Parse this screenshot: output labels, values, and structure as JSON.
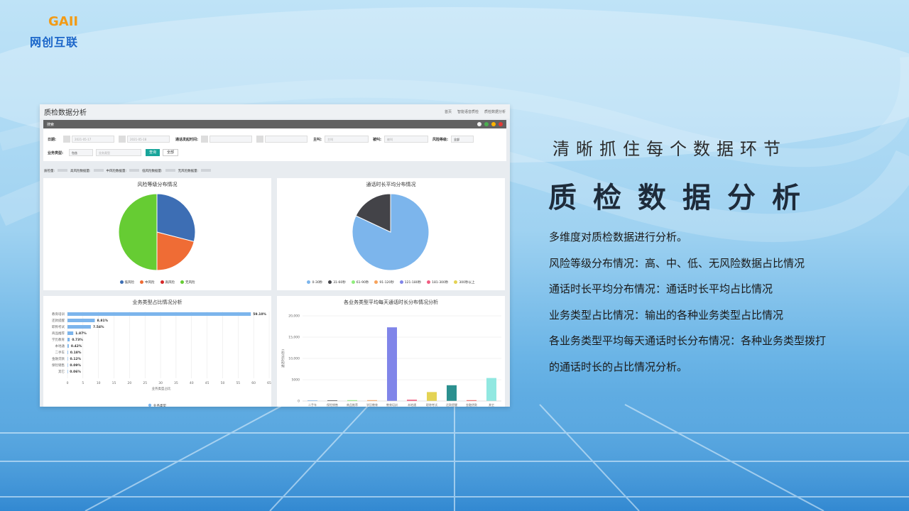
{
  "logo": {
    "mark": "GAII",
    "text": "网创互联"
  },
  "panel": {
    "title": "质检数据分析",
    "breadcrumbs": [
      "首页",
      "智能语音质检",
      "质检数据分析"
    ],
    "search_bar_label": "搜索",
    "filters": {
      "date_label": "日期:",
      "date_start": "2021-05-17",
      "date_end": "2021-05-18",
      "call_duration_label": "通话发起时间:",
      "caller_label": "主叫:",
      "caller_placeholder": "主叫",
      "callee_label": "被叫:",
      "callee_placeholder": "被叫",
      "risk_level_label": "风险等级:",
      "risk_level_value": "全部",
      "business_type_label": "业务类型:",
      "business_type_value": "包含",
      "business_type_placeholder": "业务类型",
      "query_button": "查询",
      "all_button": "全部"
    },
    "stats": [
      "质检量:",
      "高风险数据量:",
      "中风险数据量:",
      "低风险数据量:",
      "无风险数据量:"
    ],
    "risk_chart": {
      "title": "风险等级分布情况",
      "type": "pie",
      "legend": [
        "低风险",
        "中风险",
        "高风险",
        "无风险"
      ]
    },
    "duration_chart": {
      "title": "通话时长平均分布情况",
      "type": "pie",
      "legend": [
        "0-30秒",
        "31-60秒",
        "61-90秒",
        "91-120秒",
        "121-180秒",
        "181-300秒",
        "300秒以上"
      ]
    },
    "business_chart": {
      "title": "业务类型占比情况分析",
      "axis_label": "业务类型占比",
      "legend": "业务类型",
      "ticks": [
        "0",
        "5",
        "10",
        "15",
        "20",
        "25",
        "30",
        "35",
        "40",
        "45",
        "50",
        "55",
        "60",
        "65"
      ]
    },
    "avg_chart": {
      "title": "各业务类型平均每天通话时长分布情况分析",
      "ylabel": "通话时长(秒)",
      "yticks": [
        "0",
        "5000",
        "10,000",
        "15,000",
        "20,000"
      ]
    }
  },
  "chart_data": [
    {
      "type": "pie",
      "title": "风险等级分布情况",
      "categories": [
        "低风险",
        "中风险",
        "高风险",
        "无风险"
      ],
      "values": [
        29,
        21,
        0,
        50
      ],
      "colors": [
        "#3d6eb4",
        "#ef6c35",
        "#d62728",
        "#66cc33"
      ]
    },
    {
      "type": "pie",
      "title": "通话时长平均分布情况",
      "categories": [
        "0-30秒",
        "31-60秒",
        "61-90秒",
        "91-120秒",
        "121-180秒",
        "181-300秒",
        "300秒以上"
      ],
      "values": [
        82,
        18,
        0,
        0,
        0,
        0,
        0
      ],
      "colors": [
        "#7cb5ec",
        "#434348",
        "#90ed7d",
        "#f7a35c",
        "#8085e9",
        "#f15c80",
        "#e4d354"
      ]
    },
    {
      "type": "bar",
      "title": "业务类型占比情况分析",
      "categories": [
        "教育培训",
        "还款提醒",
        "职称考试",
        "商品推荐",
        "学历教育",
        "本地通",
        "二手车",
        "金融贷款",
        "保险销售",
        "其它"
      ],
      "values": [
        59.1,
        8.81,
        7.54,
        1.87,
        0.73,
        0.42,
        0.18,
        0.12,
        0.09,
        0.06
      ],
      "labels": [
        "59.10%",
        "8.81%",
        "7.54%",
        "1.87%",
        "0.73%",
        "0.42%",
        "0.18%",
        "0.12%",
        "0.09%",
        "0.06%"
      ],
      "xlim": [
        0,
        65
      ],
      "xlabel": "业务类型占比",
      "series_name": "业务类型",
      "color": "#7cb5ec"
    },
    {
      "type": "bar",
      "title": "各业务类型平均每天通话时长分布情况分析",
      "categories": [
        "二手车",
        "保险销售",
        "商品推荐",
        "学历教育",
        "教育培训",
        "本地通",
        "职称考试",
        "还款提醒",
        "金融贷款",
        "其它"
      ],
      "values": [
        150,
        150,
        200,
        200,
        17300,
        300,
        2100,
        3700,
        200,
        5400
      ],
      "colors": [
        "#7cb5ec",
        "#434348",
        "#90ed7d",
        "#f7a35c",
        "#8085e9",
        "#f15c80",
        "#e4d354",
        "#2b908f",
        "#f45b5b",
        "#91e8e1"
      ],
      "ylim": [
        0,
        20000
      ],
      "ylabel": "通话时长(秒)"
    }
  ],
  "right": {
    "slogan": "清晰抓住每个数据环节",
    "heading": "质检数据分析",
    "lines": [
      "多维度对质检数据进行分析。",
      "风险等级分布情况：高、中、低、无风险数据占比情况",
      "通话时长平均分布情况：通话时长平均占比情况",
      "业务类型占比情况：输出的各种业务类型占比情况",
      "各业务类型平均每天通话时长分布情况：各种业务类型拨打",
      "的通话时长的占比情况分析。"
    ]
  }
}
